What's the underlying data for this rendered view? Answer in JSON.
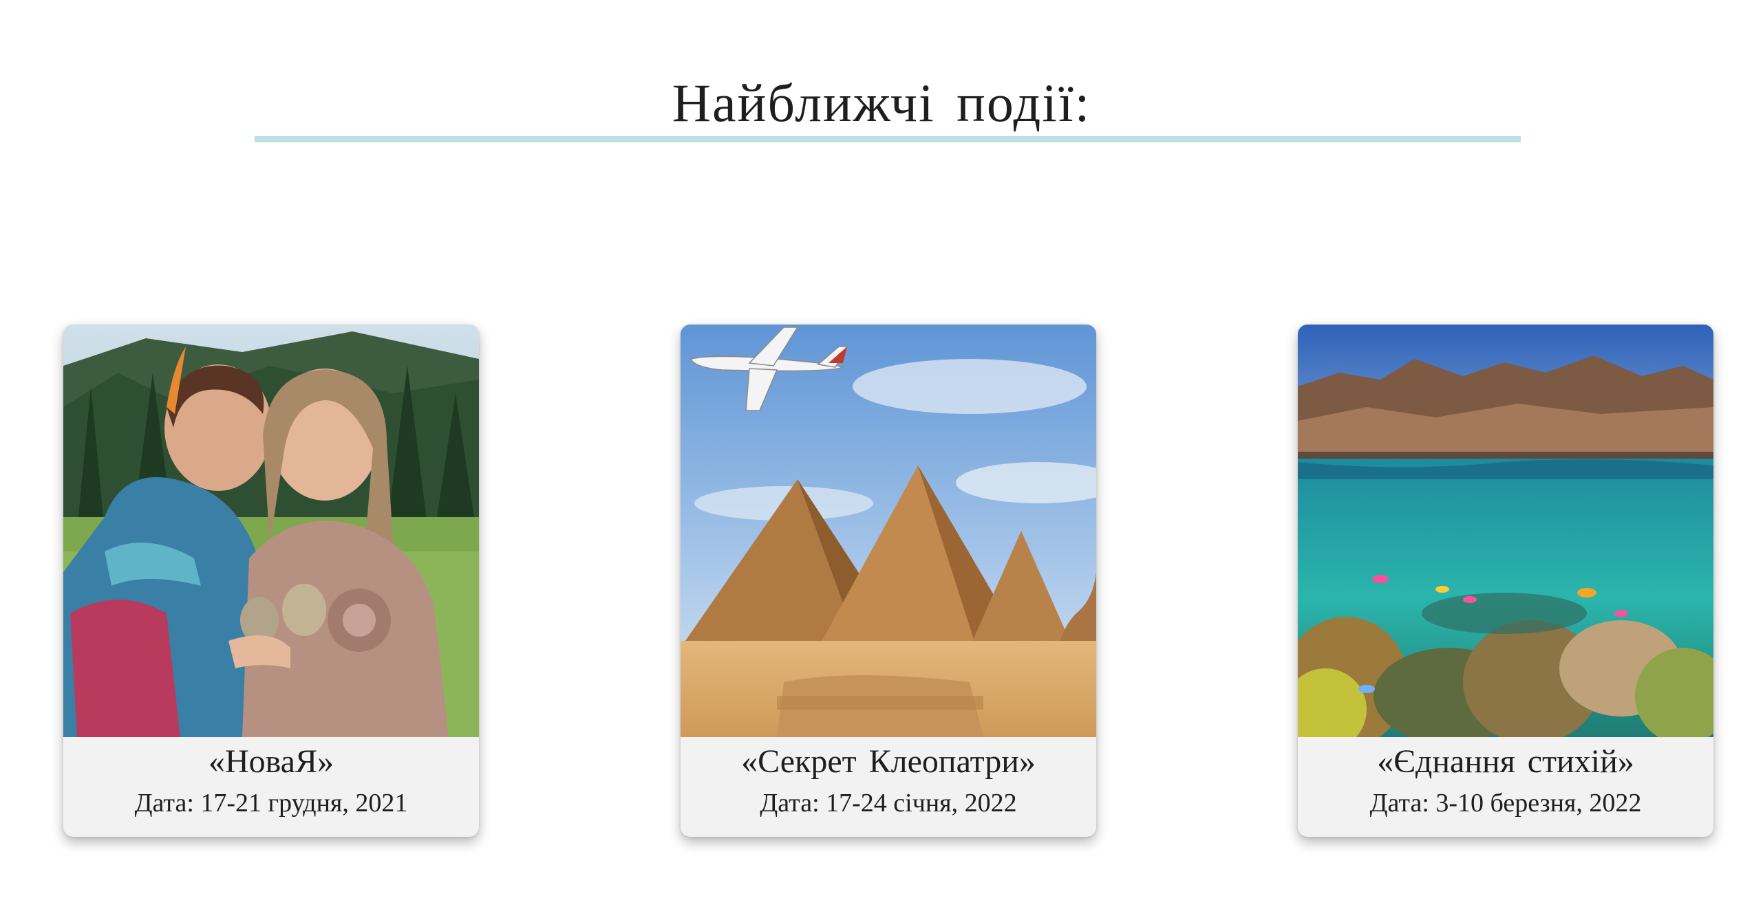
{
  "section": {
    "title": "Найближчі події:"
  },
  "colors": {
    "underline": "#bde0e2",
    "card_background": "#f2f2f2"
  },
  "events": [
    {
      "title": "«НоваЯ»",
      "date": "Дата: 17-21 грудня, 2021",
      "image": "two-women-in-mountain-meadow-photo"
    },
    {
      "title": "«Секрет Клеопатри»",
      "date": "Дата: 17-24 січня, 2022",
      "image": "pyramids-and-airplane-photo"
    },
    {
      "title": "«Єднання стихій»",
      "date": "Дата: 3-10 березня, 2022",
      "image": "red-sea-coral-reef-photo"
    }
  ]
}
